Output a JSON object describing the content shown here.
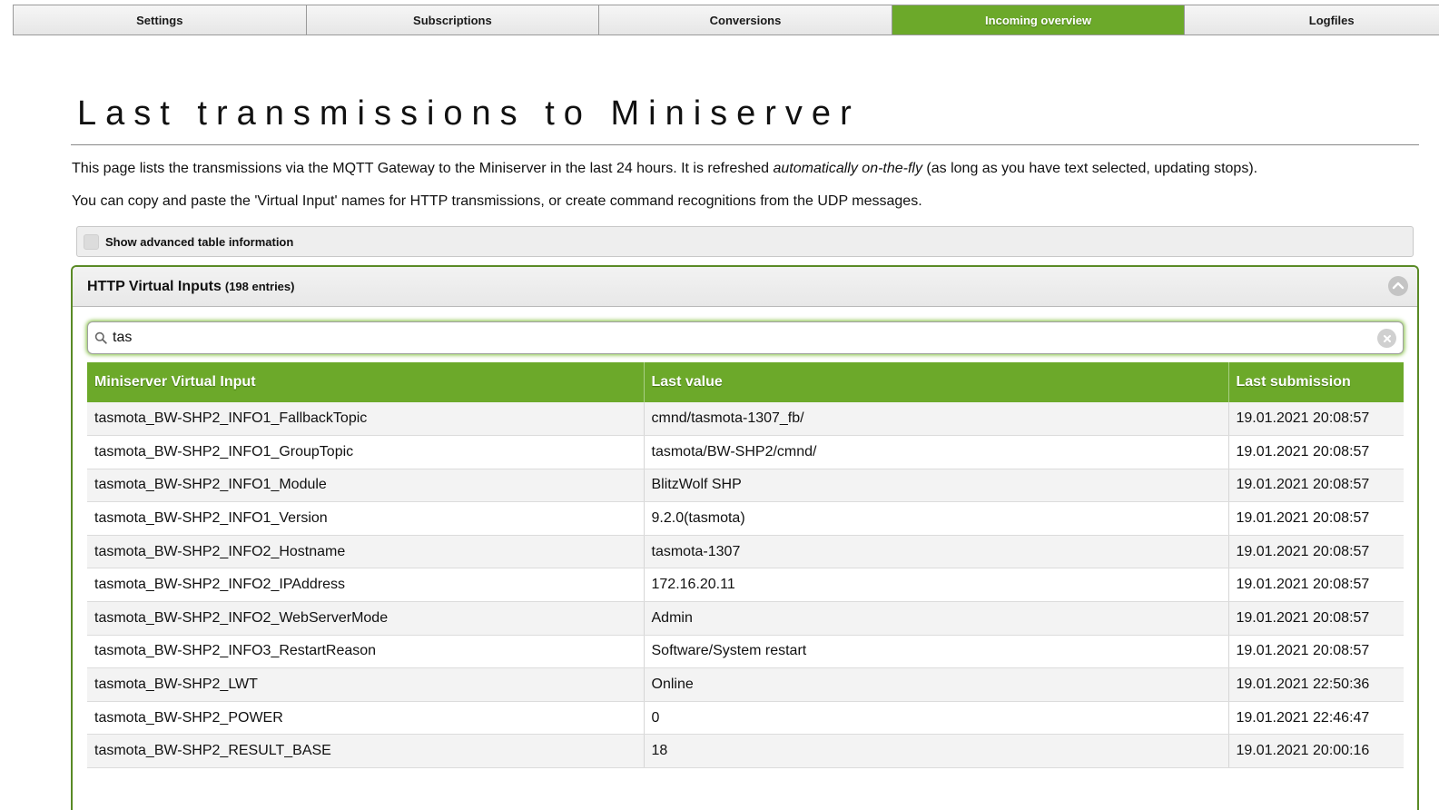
{
  "nav": {
    "tabs": [
      {
        "label": "Settings"
      },
      {
        "label": "Subscriptions"
      },
      {
        "label": "Conversions"
      },
      {
        "label": "Incoming overview",
        "active": true
      },
      {
        "label": "Logfiles"
      }
    ]
  },
  "page": {
    "title": "Last transmissions to Miniserver",
    "intro_p1_before": "This page lists the transmissions via the MQTT Gateway to the Miniserver in the last 24 hours. It is refreshed ",
    "intro_p1_emphasis": "automatically on-the-fly",
    "intro_p1_after": " (as long as you have text selected, updating stops).",
    "intro_p2": "You can copy and paste the 'Virtual Input' names for HTTP transmissions, or create command recognitions from the UDP messages."
  },
  "advanced": {
    "label": "Show advanced table information",
    "checked": false
  },
  "panel": {
    "title": "HTTP Virtual Inputs",
    "count": "(198 entries)",
    "search_value": "tas",
    "collapse_icon": "chevron-up-icon",
    "clear_icon": "clear-icon",
    "search_icon": "search-icon"
  },
  "colors": {
    "accent": "#6ca92a",
    "panel_border": "#5a8a26"
  },
  "table": {
    "headers": [
      "Miniserver Virtual Input",
      "Last value",
      "Last submission"
    ],
    "rows": [
      [
        "tasmota_BW-SHP2_INFO1_FallbackTopic",
        "cmnd/tasmota-1307_fb/",
        "19.01.2021 20:08:57"
      ],
      [
        "tasmota_BW-SHP2_INFO1_GroupTopic",
        "tasmota/BW-SHP2/cmnd/",
        "19.01.2021 20:08:57"
      ],
      [
        "tasmota_BW-SHP2_INFO1_Module",
        "BlitzWolf SHP",
        "19.01.2021 20:08:57"
      ],
      [
        "tasmota_BW-SHP2_INFO1_Version",
        "9.2.0(tasmota)",
        "19.01.2021 20:08:57"
      ],
      [
        "tasmota_BW-SHP2_INFO2_Hostname",
        "tasmota-1307",
        "19.01.2021 20:08:57"
      ],
      [
        "tasmota_BW-SHP2_INFO2_IPAddress",
        "172.16.20.11",
        "19.01.2021 20:08:57"
      ],
      [
        "tasmota_BW-SHP2_INFO2_WebServerMode",
        "Admin",
        "19.01.2021 20:08:57"
      ],
      [
        "tasmota_BW-SHP2_INFO3_RestartReason",
        "Software/System restart",
        "19.01.2021 20:08:57"
      ],
      [
        "tasmota_BW-SHP2_LWT",
        "Online",
        "19.01.2021 22:50:36"
      ],
      [
        "tasmota_BW-SHP2_POWER",
        "0",
        "19.01.2021 22:46:47"
      ],
      [
        "tasmota_BW-SHP2_RESULT_BASE",
        "18",
        "19.01.2021 20:00:16"
      ]
    ]
  }
}
